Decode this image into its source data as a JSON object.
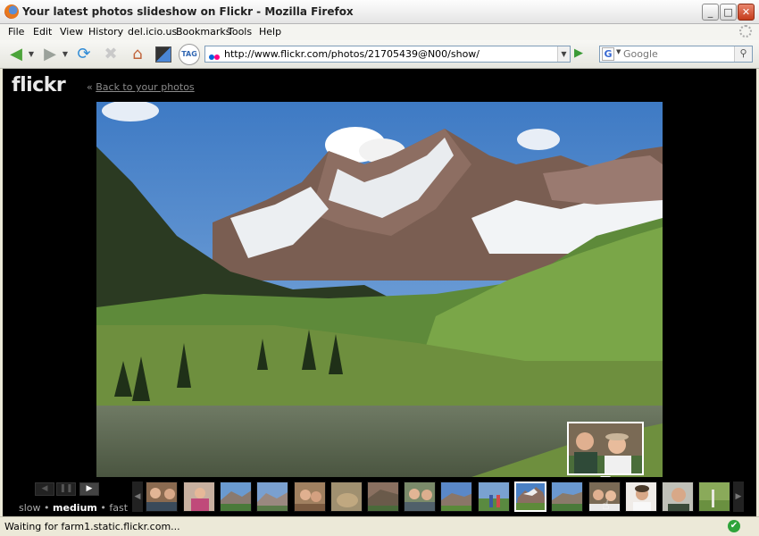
{
  "window": {
    "title": "Your latest photos slideshow on Flickr - Mozilla Firefox",
    "minimize": "_",
    "maximize": "□",
    "close": "✕"
  },
  "menu": [
    "File",
    "Edit",
    "View",
    "History",
    "del.icio.us",
    "Bookmarks",
    "Tools",
    "Help"
  ],
  "toolbar": {
    "url": "http://www.flickr.com/photos/21705439@N00/show/",
    "search_placeholder": "Google",
    "search_engine_letter": "G",
    "tag_label": "TAG"
  },
  "page": {
    "logo": "flickr",
    "back_prefix": "«",
    "back_link": "Back to your photos"
  },
  "slideshow": {
    "speed_options": [
      "slow",
      "medium",
      "fast"
    ],
    "speed_separator": "•",
    "selected_speed": "medium",
    "thumbnail_count": 16,
    "selected_thumbnail": 10,
    "hovered_thumbnail": 12
  },
  "status": {
    "text": "Waiting for farm1.static.flickr.com...",
    "security_icon": "✔"
  },
  "colors": {
    "page_bg": "#000000",
    "chrome_bg": "#ece9d8",
    "link_grey": "#8a8a8a",
    "flickr_blue": "#0063dc",
    "flickr_pink": "#ff0084"
  }
}
